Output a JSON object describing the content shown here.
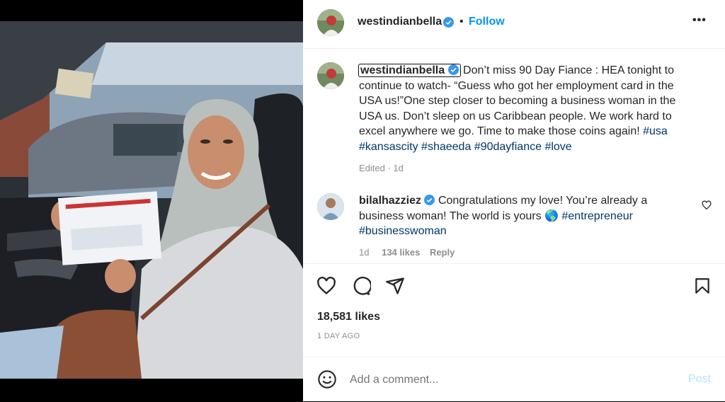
{
  "post": {
    "username": "westindianbella",
    "follow_label": "Follow",
    "more_label": "•••",
    "caption_username": "westindianbella",
    "caption_text": "Don’t miss 90 Day Fiance : HEA tonight to continue to watch- “Guess who got her employment card in the USA us!”One step closer to becoming a business woman in the USA us. Don’t sleep on us Caribbean people. We work hard to excel anywhere we go. Time to make those coins again!",
    "caption_tags": [
      "#usa",
      "#kansascity",
      "#shaeeda",
      "#90dayfiance",
      "#love"
    ],
    "caption_meta": "Edited · 1d"
  },
  "comment": {
    "username": "bilalhazziez",
    "text_part1": "Congratulations my love! You’re already a business woman! The world is yours",
    "emoji": "🌎",
    "tags": [
      "#entrepreneur",
      "#businesswoman"
    ],
    "time": "1d",
    "likes": "134 likes",
    "reply_label": "Reply"
  },
  "stats": {
    "likes": "18,581 likes",
    "date": "1 DAY AGO"
  },
  "add_comment": {
    "placeholder": "Add a comment...",
    "post_label": "Post"
  },
  "colors": {
    "link": "#0095f6",
    "hashtag": "#00376b",
    "meta": "#8e8e8e",
    "post_disabled": "#b2dffc"
  },
  "icons": [
    "heart-icon",
    "comment-icon",
    "share-icon",
    "bookmark-icon",
    "emoji-icon",
    "more-icon",
    "verified-badge-icon"
  ]
}
